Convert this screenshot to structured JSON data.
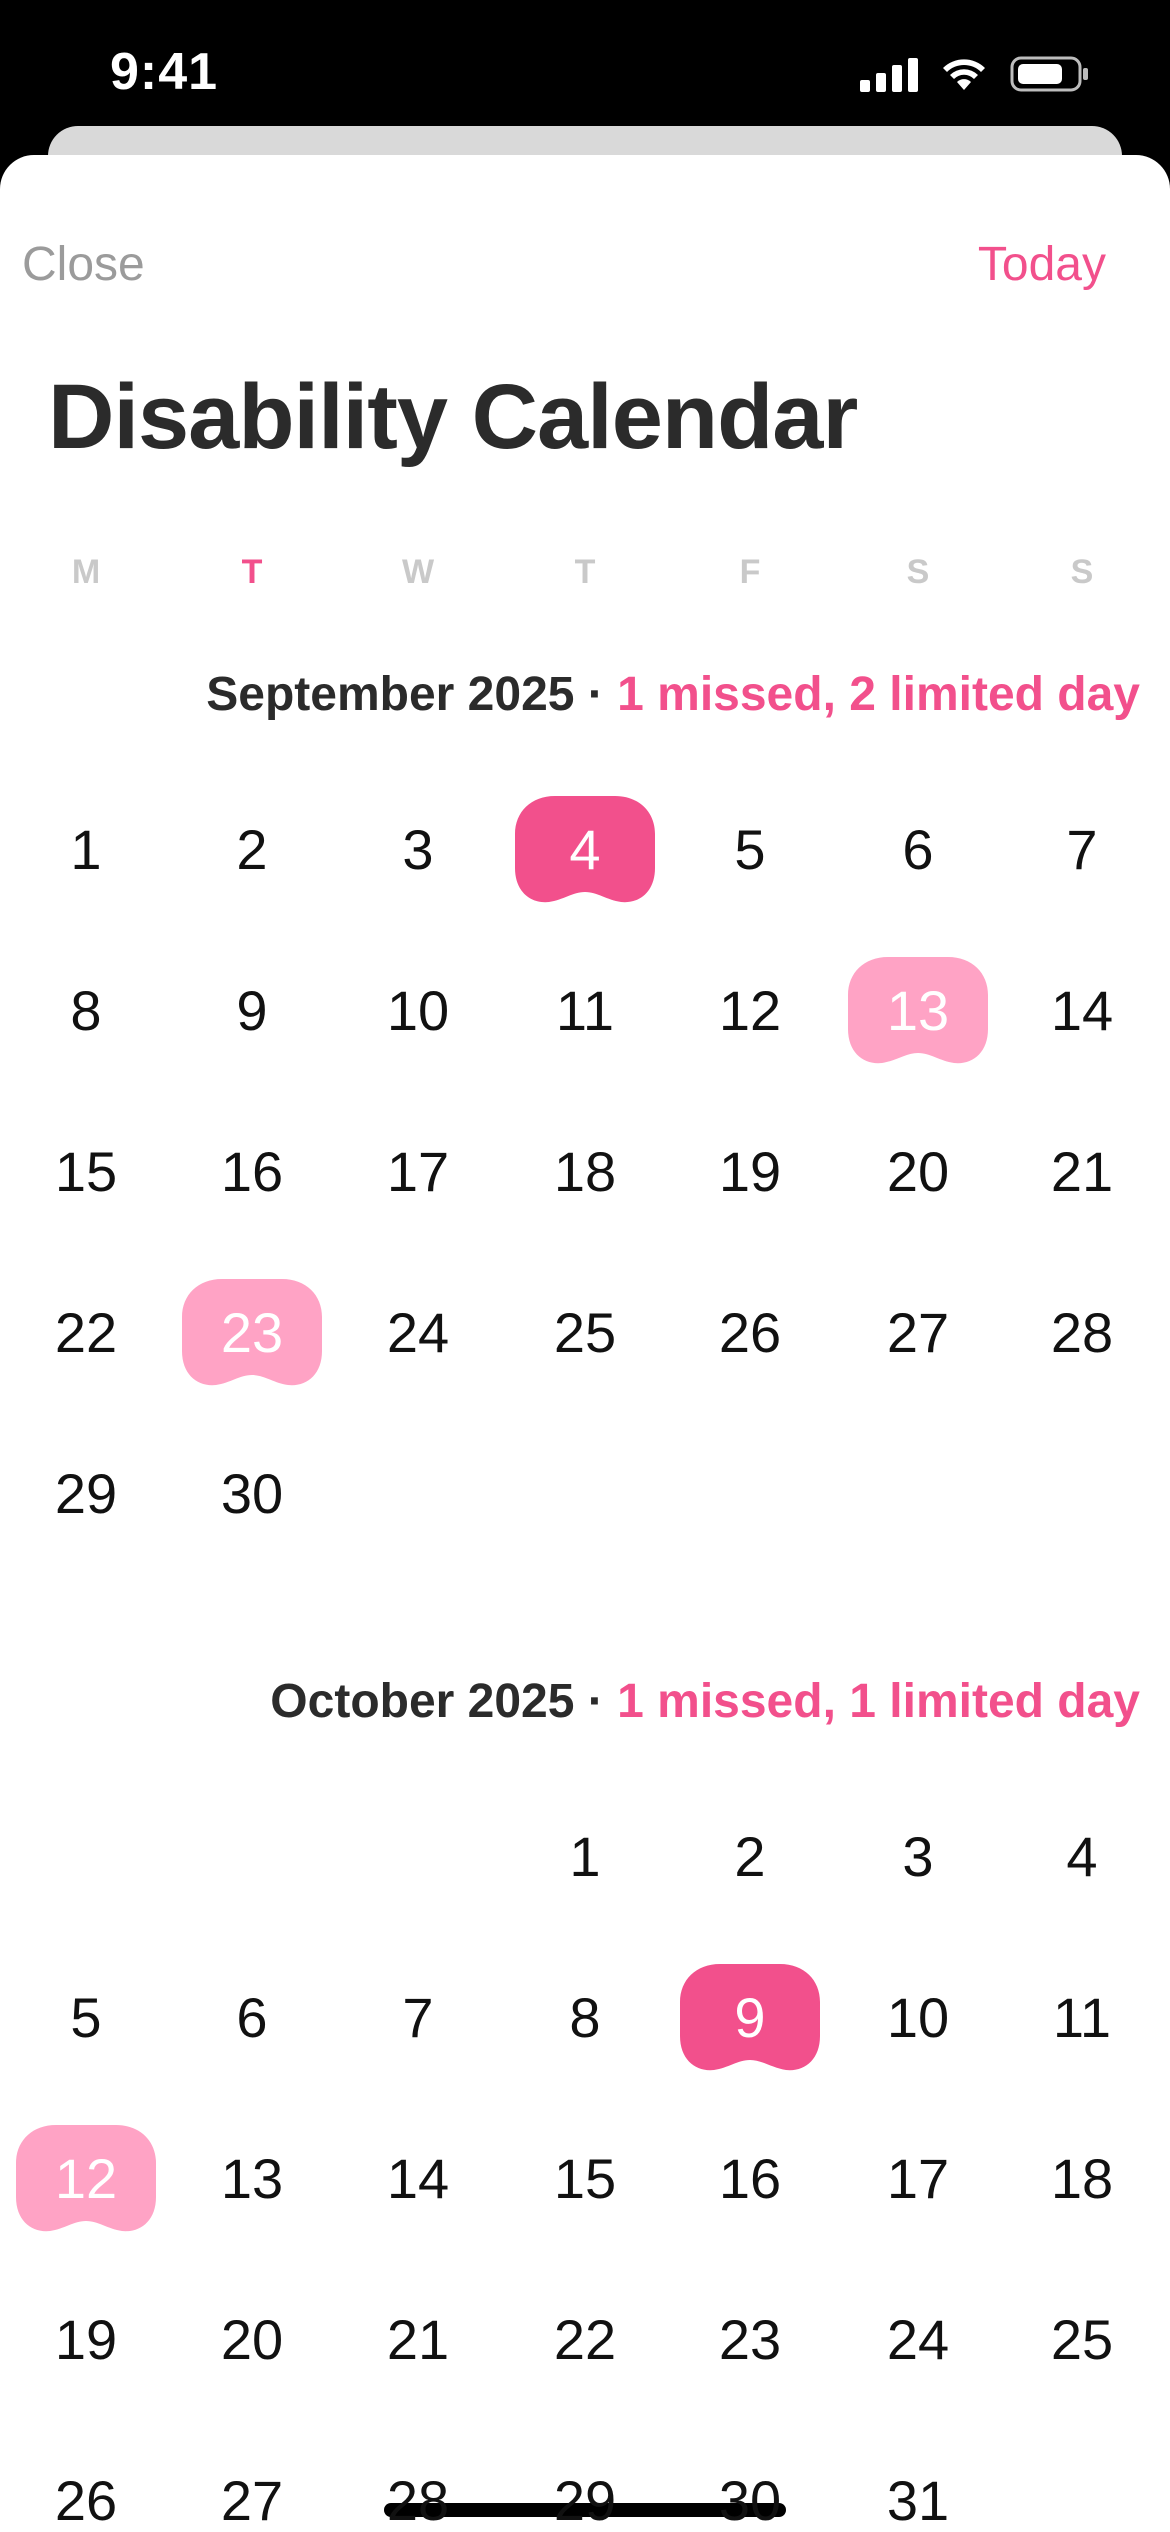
{
  "status_bar": {
    "time": "9:41"
  },
  "nav": {
    "close_label": "Close",
    "today_label": "Today"
  },
  "title": "Disability Calendar",
  "weekdays": [
    "M",
    "T",
    "W",
    "T",
    "F",
    "S",
    "S"
  ],
  "today_weekday_index": 1,
  "colors": {
    "accent": "#f2508c",
    "missed": "#f2508c",
    "limited": "#ffa3c5",
    "text": "#111111"
  },
  "months": [
    {
      "name": "September 2025",
      "separator": " · ",
      "summary": "1 missed, 2 limited day",
      "first_weekday": 0,
      "days_in_month": 30,
      "missed_days": [
        4
      ],
      "limited_days": [
        13,
        23
      ]
    },
    {
      "name": "October 2025",
      "separator": " · ",
      "summary": "1 missed, 1 limited day",
      "first_weekday": 3,
      "days_in_month": 31,
      "missed_days": [
        9
      ],
      "limited_days": [
        12
      ]
    }
  ]
}
